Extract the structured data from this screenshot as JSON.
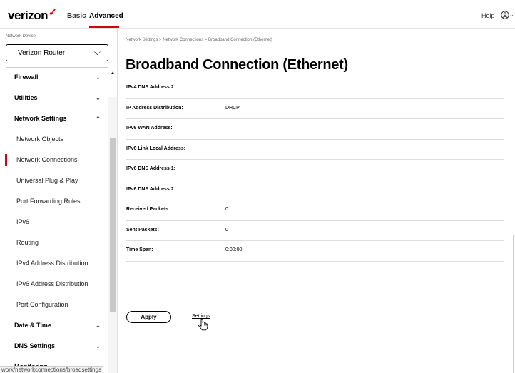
{
  "header": {
    "logo_text": "verizon",
    "logo_check": "✓",
    "tabs": [
      "Basic",
      "Advanced"
    ],
    "active_tab": "Advanced",
    "help": "Help",
    "user_icon": "user-icon",
    "accent_color": "#cd040b"
  },
  "sidebar": {
    "device_label": "Network Device",
    "device_select": "Verizon Router",
    "items": [
      {
        "label": "Firewall",
        "type": "header",
        "chev": "⌄"
      },
      {
        "label": "Utilities",
        "type": "header",
        "chev": "⌄"
      },
      {
        "label": "Network Settings",
        "type": "header",
        "chev": "⌃"
      },
      {
        "label": "Network Objects",
        "type": "sub"
      },
      {
        "label": "Network Connections",
        "type": "sub",
        "active": true
      },
      {
        "label": "Universal Plug & Play",
        "type": "sub"
      },
      {
        "label": "Port Forwarding Rules",
        "type": "sub"
      },
      {
        "label": "IPv6",
        "type": "sub"
      },
      {
        "label": "Routing",
        "type": "sub"
      },
      {
        "label": "IPv4 Address Distribution",
        "type": "sub"
      },
      {
        "label": "IPv6 Address Distribution",
        "type": "sub"
      },
      {
        "label": "Port Configuration",
        "type": "sub"
      },
      {
        "label": "Date & Time",
        "type": "header",
        "chev": "⌄"
      },
      {
        "label": "DNS Settings",
        "type": "header",
        "chev": "⌄"
      },
      {
        "label": "Monitoring",
        "type": "header",
        "chev": "⌄"
      }
    ]
  },
  "status_url": "work/networkconnections/broadsettings",
  "main": {
    "breadcrumb": "Network Settings  >  Network Connections  >  Broadband Connection (Ethernet)",
    "title": "Broadband Connection (Ethernet)",
    "rows": [
      {
        "label": "IPv4 DNS Address 2:",
        "value": ""
      },
      {
        "label": "IP Address Distribution:",
        "value": "DHCP"
      },
      {
        "label": "IPv6 WAN Address:",
        "value": ""
      },
      {
        "label": "IPv6 Link Local Address:",
        "value": ""
      },
      {
        "label": "IPv6 DNS Address 1:",
        "value": ""
      },
      {
        "label": "IPv6 DNS Address 2:",
        "value": ""
      },
      {
        "label": "Received Packets:",
        "value": "0"
      },
      {
        "label": "Sent Packets:",
        "value": "0"
      },
      {
        "label": "Time Span:",
        "value": "0:00:00"
      }
    ],
    "apply_label": "Apply",
    "settings_label": "Settings"
  }
}
